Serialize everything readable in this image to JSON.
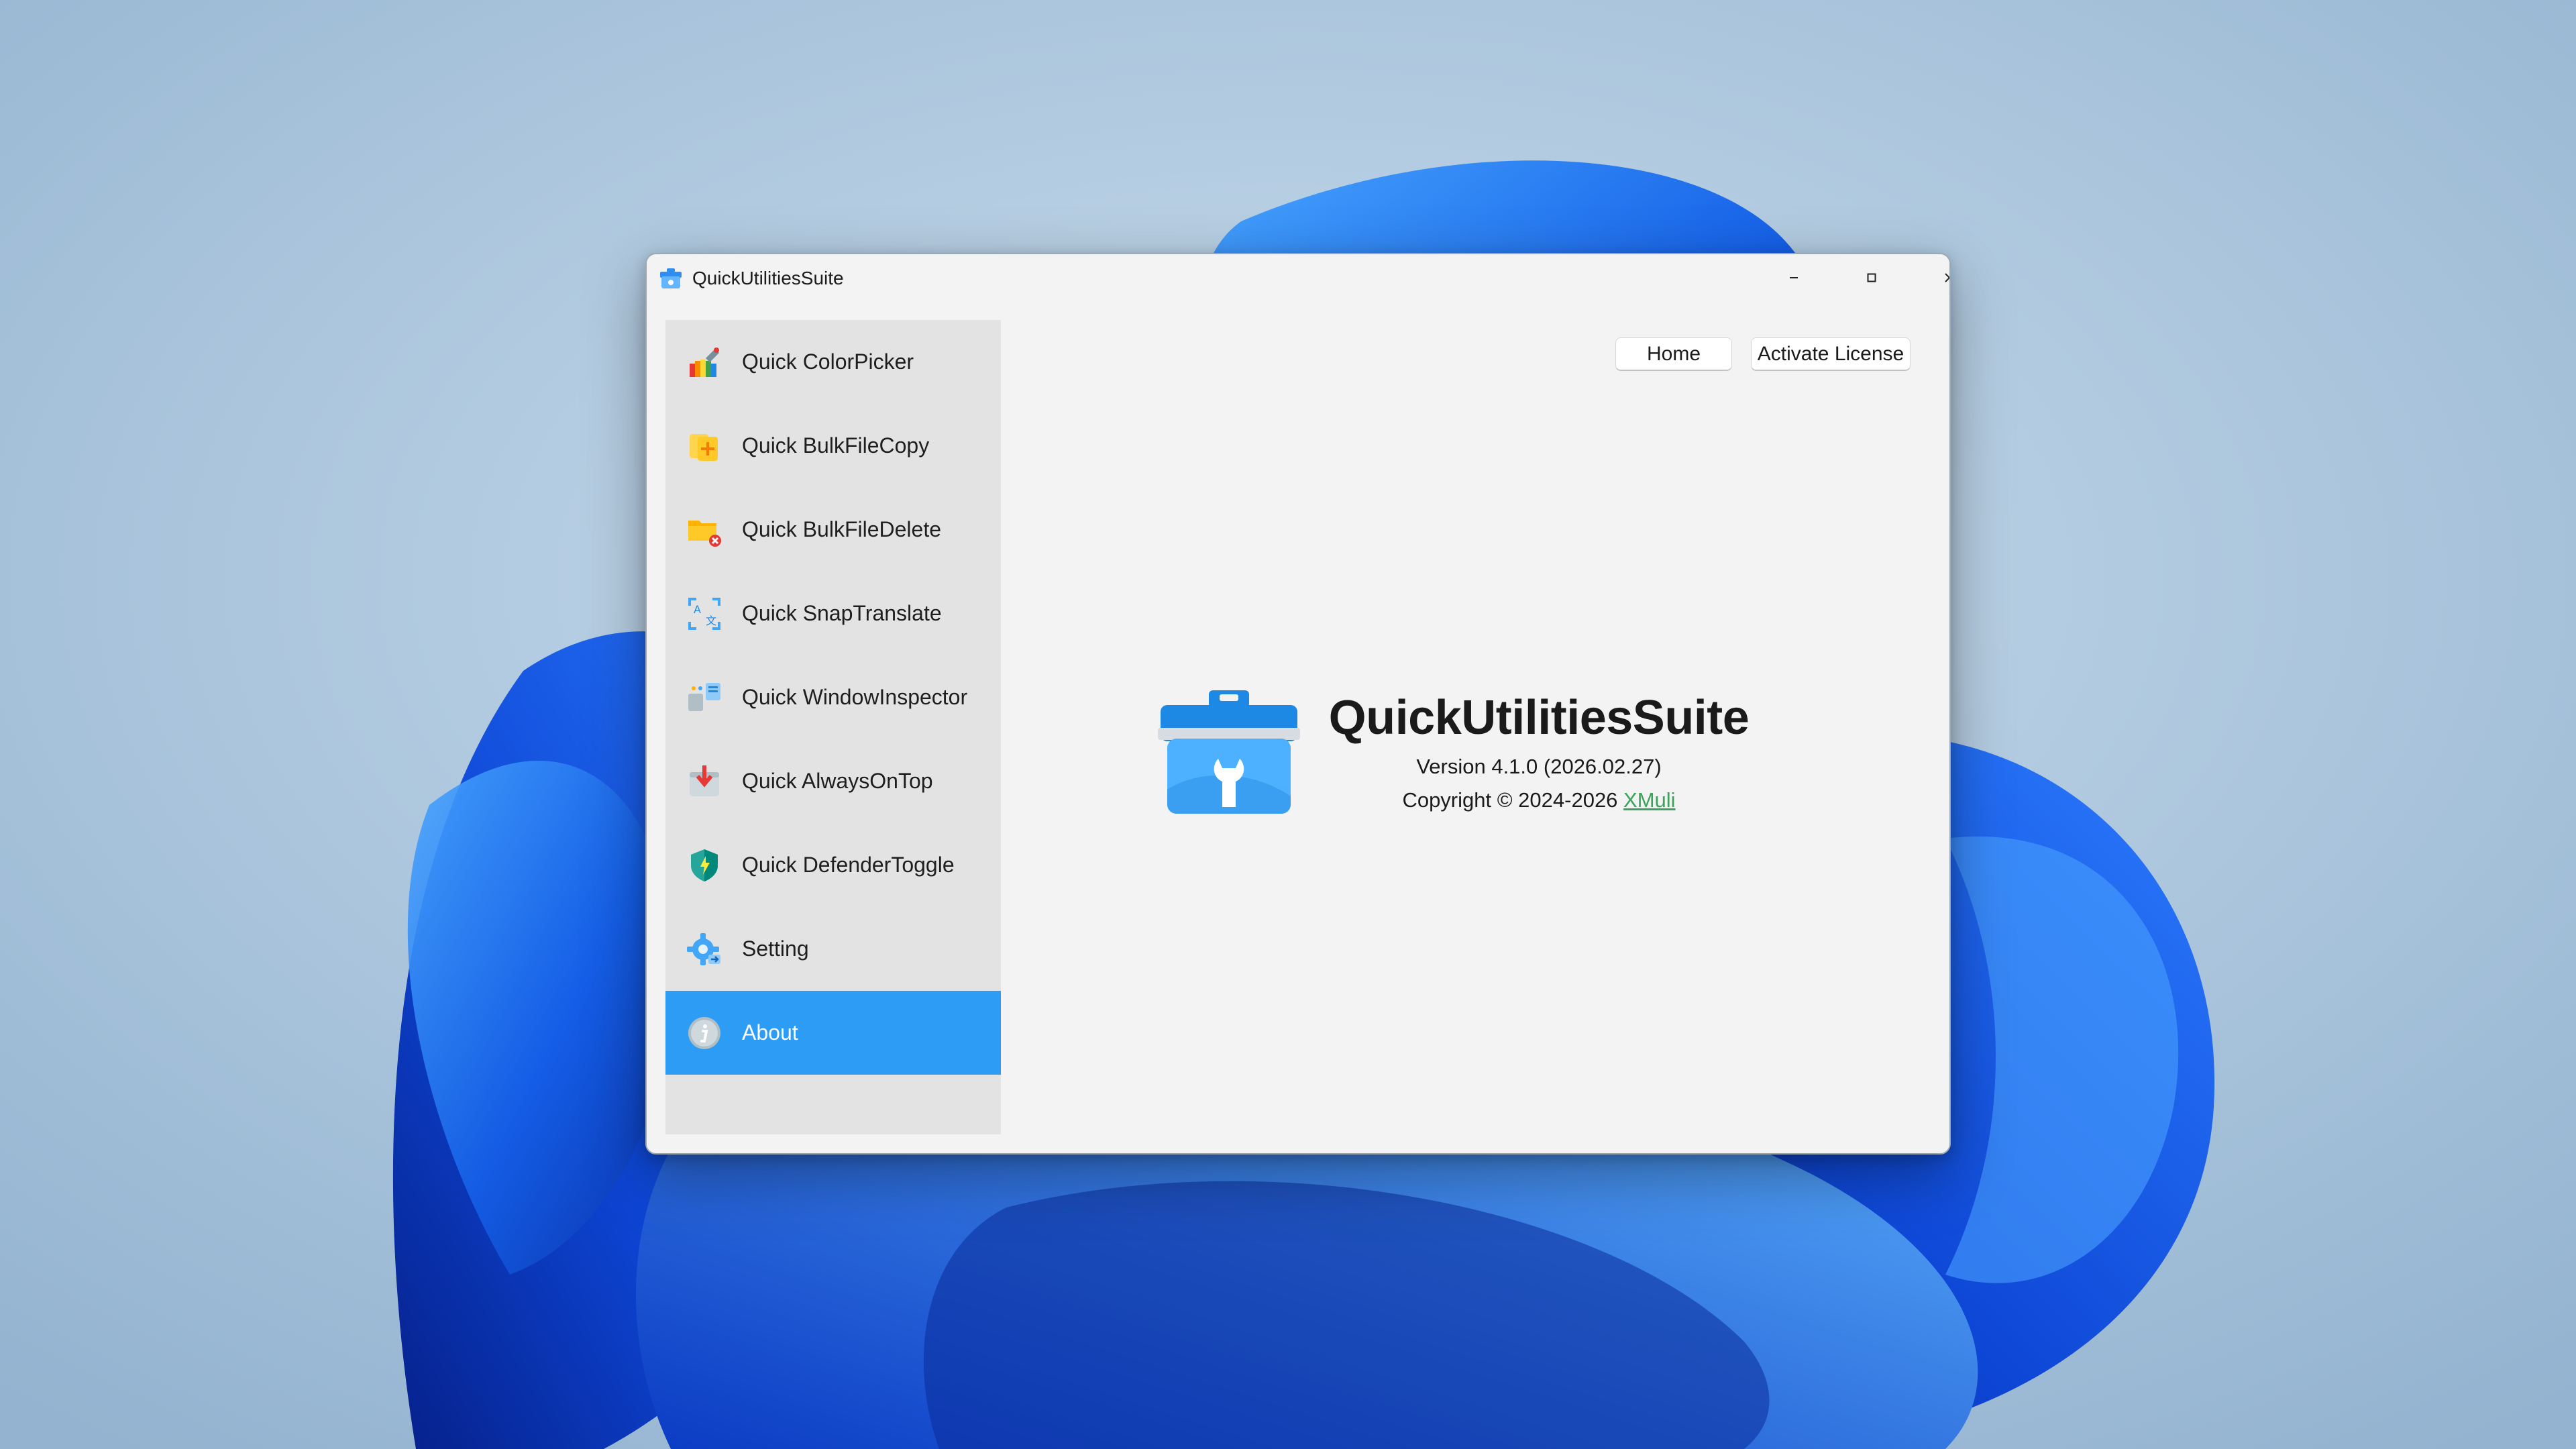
{
  "window": {
    "title": "QuickUtilitiesSuite"
  },
  "sidebar": {
    "items": [
      {
        "label": "Quick ColorPicker",
        "icon": "color-picker-icon"
      },
      {
        "label": "Quick BulkFileCopy",
        "icon": "file-copy-icon"
      },
      {
        "label": "Quick BulkFileDelete",
        "icon": "file-delete-icon"
      },
      {
        "label": "Quick SnapTranslate",
        "icon": "translate-icon"
      },
      {
        "label": "Quick WindowInspector",
        "icon": "window-inspector-icon"
      },
      {
        "label": "Quick AlwaysOnTop",
        "icon": "pin-on-top-icon"
      },
      {
        "label": "Quick DefenderToggle",
        "icon": "shield-icon"
      },
      {
        "label": "Setting",
        "icon": "settings-gear-icon"
      },
      {
        "label": "About",
        "icon": "info-icon"
      }
    ],
    "active_index": 8
  },
  "toolbar": {
    "home_label": "Home",
    "license_label": "Activate License"
  },
  "about": {
    "title": "QuickUtilitiesSuite",
    "version": "Version 4.1.0 (2026.02.27)",
    "copyright_prefix": "Copyright © 2024-2026 ",
    "author_link": "XMuli"
  },
  "colors": {
    "accent": "#2c9cf5",
    "link": "#3aa35a",
    "sidebar_bg": "#e3e3e3",
    "window_bg": "#f3f3f3"
  }
}
